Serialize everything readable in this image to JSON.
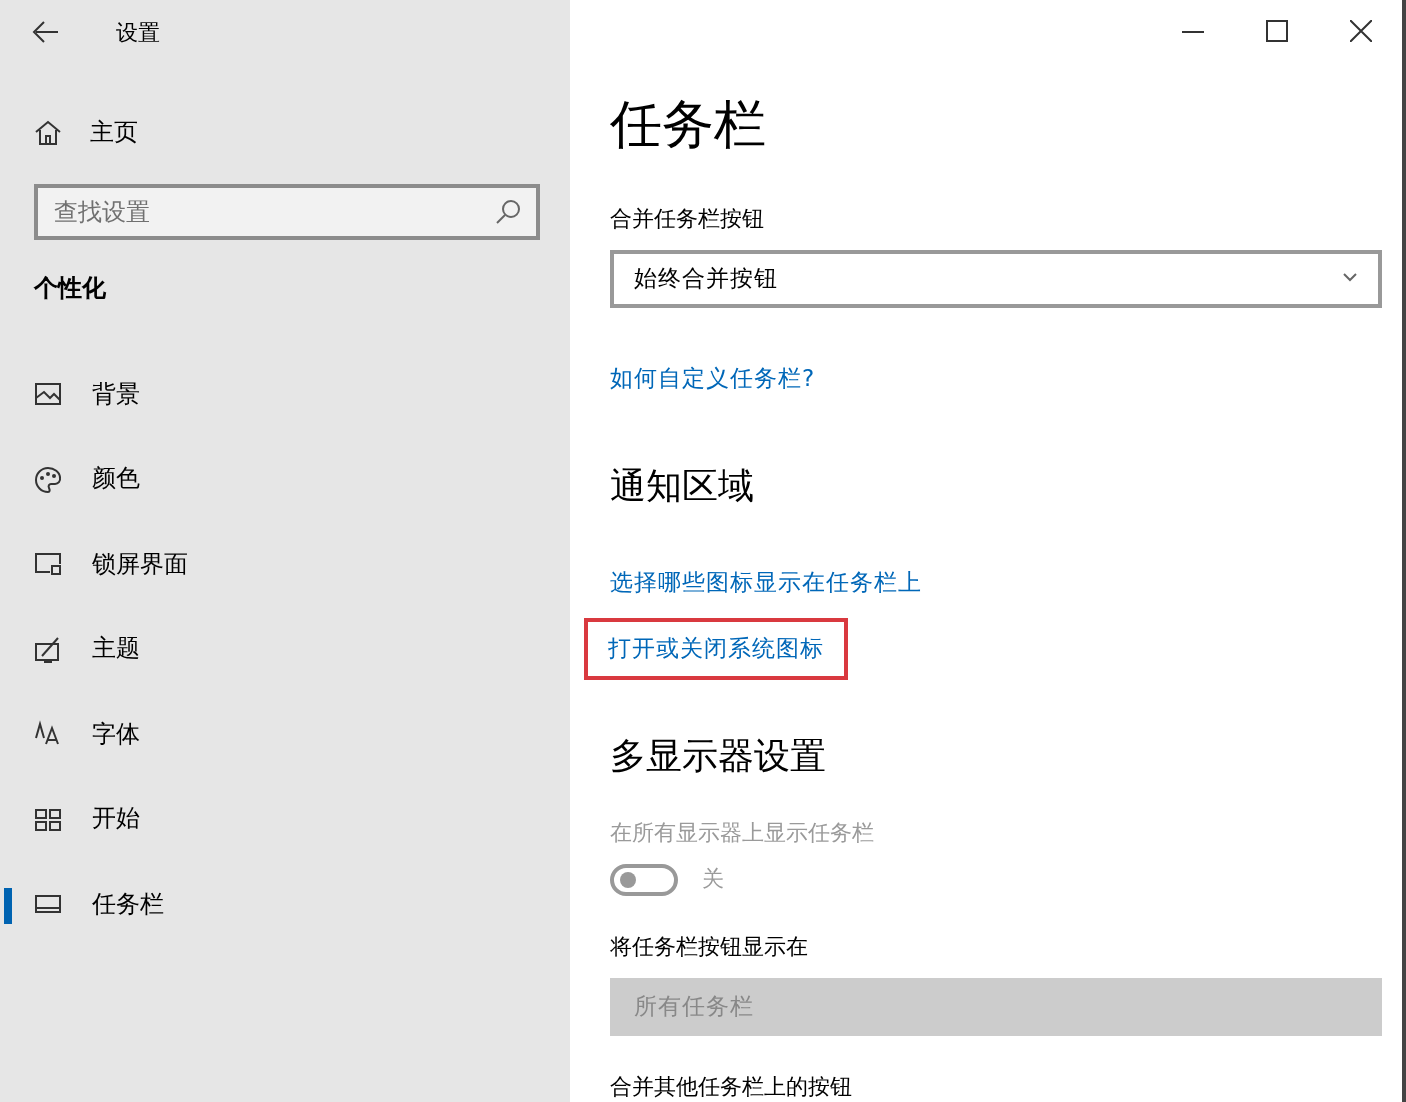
{
  "window": {
    "title": "设置"
  },
  "sidebar": {
    "home": "主页",
    "search": {
      "placeholder": "查找设置"
    },
    "section": "个性化",
    "items": [
      {
        "label": "背景",
        "selected": false
      },
      {
        "label": "颜色",
        "selected": false
      },
      {
        "label": "锁屏界面",
        "selected": false
      },
      {
        "label": "主题",
        "selected": false
      },
      {
        "label": "字体",
        "selected": false
      },
      {
        "label": "开始",
        "selected": false
      },
      {
        "label": "任务栏",
        "selected": true
      }
    ]
  },
  "content": {
    "title": "任务栏",
    "blocks": [
      {
        "kind": "label",
        "text": "合并任务栏按钮"
      },
      {
        "kind": "dropdown",
        "value": "始终合并按钮",
        "disabled": false
      },
      {
        "kind": "link",
        "text": "如何自定义任务栏?",
        "highlighted": false
      },
      {
        "kind": "heading",
        "text": "通知区域"
      },
      {
        "kind": "link",
        "text": "选择哪些图标显示在任务栏上",
        "highlighted": false
      },
      {
        "kind": "link",
        "text": "打开或关闭系统图标",
        "highlighted": true
      },
      {
        "kind": "heading",
        "text": "多显示器设置"
      },
      {
        "kind": "label",
        "text": "在所有显示器上显示任务栏",
        "disabled": true
      },
      {
        "kind": "toggle",
        "on": false,
        "text": "关",
        "disabled": true
      },
      {
        "kind": "label",
        "text": "将任务栏按钮显示在"
      },
      {
        "kind": "dropdown",
        "value": "所有任务栏",
        "disabled": true
      },
      {
        "kind": "label",
        "text": "合并其他任务栏上的按钮"
      }
    ]
  }
}
